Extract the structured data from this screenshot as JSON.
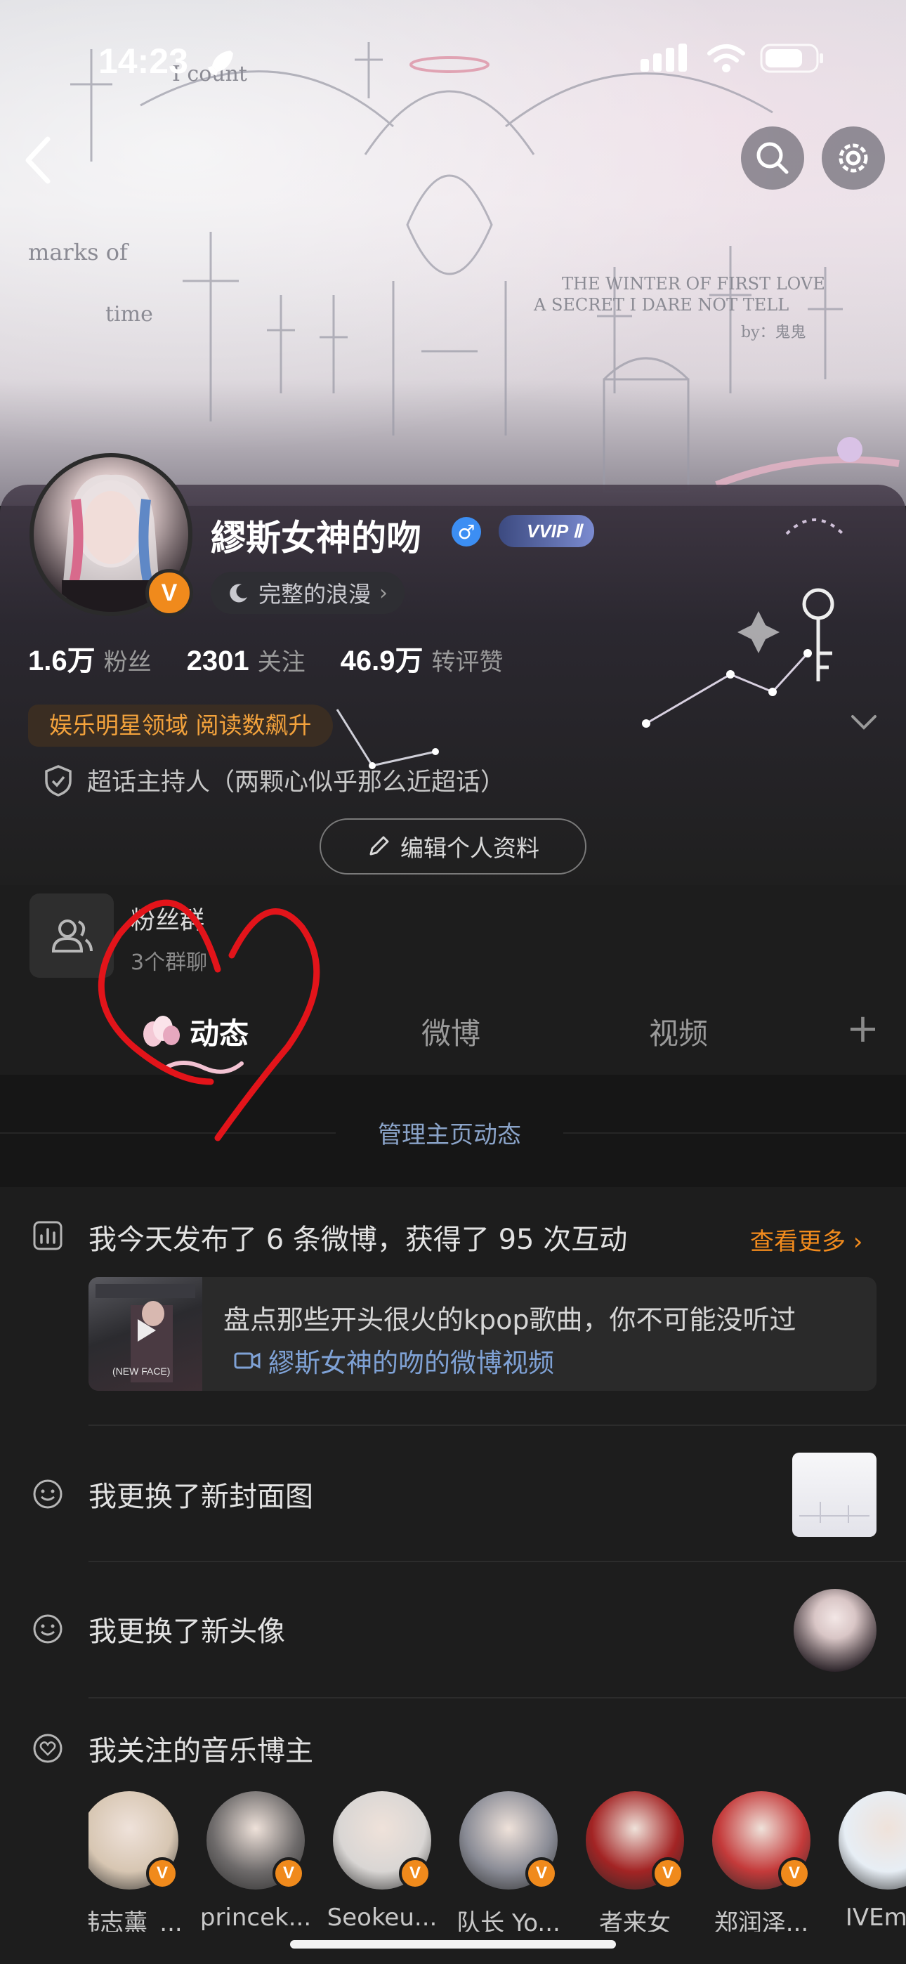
{
  "status_bar": {
    "time": "14:23"
  },
  "cover": {
    "texts": [
      "I count",
      "marks of",
      "time",
      "THE WINTER OF FIRST LOVE",
      "A SECRET I DARE NOT TELL",
      "by：鬼鬼"
    ]
  },
  "profile": {
    "username": "繆斯女神的吻",
    "vip_label": "VVIP Ⅱ",
    "badge_label": "完整的浪漫",
    "stats": [
      {
        "value": "1.6万",
        "label": "粉丝"
      },
      {
        "value": "2301",
        "label": "关注"
      },
      {
        "value": "46.9万",
        "label": "转评赞"
      }
    ],
    "domain_tag": "娱乐明星领域 阅读数飙升",
    "supertopic": "超话主持人（两颗心似乎那么近超话）",
    "edit_button": "编辑个人资料",
    "fan_group": {
      "title": "粉丝群",
      "subtitle": "3个群聊"
    }
  },
  "tabs": [
    {
      "label": "动态",
      "active": true
    },
    {
      "label": "微博",
      "active": false
    },
    {
      "label": "视频",
      "active": false
    }
  ],
  "manage_label": "管理主页动态",
  "feed": {
    "summary": "我今天发布了 6 条微博，获得了 95 次互动",
    "more_label": "查看更多",
    "video": {
      "title": "盘点那些开头很火的kpop歌曲，你不可能没听过",
      "source": "繆斯女神的吻的微博视频",
      "thumb_caption": "(NEW FACE)"
    },
    "cover_changed": "我更换了新封面图",
    "avatar_changed": "我更换了新头像",
    "music_bloggers_title": "我关注的音乐博主",
    "bloggers": [
      {
        "name": "韩志薰_...",
        "color": "#d7c6b2"
      },
      {
        "name": "princek...",
        "color": "#6e6b6b"
      },
      {
        "name": "Seokeu...",
        "color": "#d9d6d4"
      },
      {
        "name": "队长 Yo...",
        "color": "#8a8c96"
      },
      {
        "name": "者来女",
        "color": "#a32424"
      },
      {
        "name": "郑润泽...",
        "color": "#c43a3a"
      },
      {
        "name": "IVEm...",
        "color": "#e7eef5"
      }
    ]
  },
  "colors": {
    "accent_orange": "#f28b1d",
    "link_blue": "#7fa2d6",
    "annotation_red": "#e2141a"
  }
}
